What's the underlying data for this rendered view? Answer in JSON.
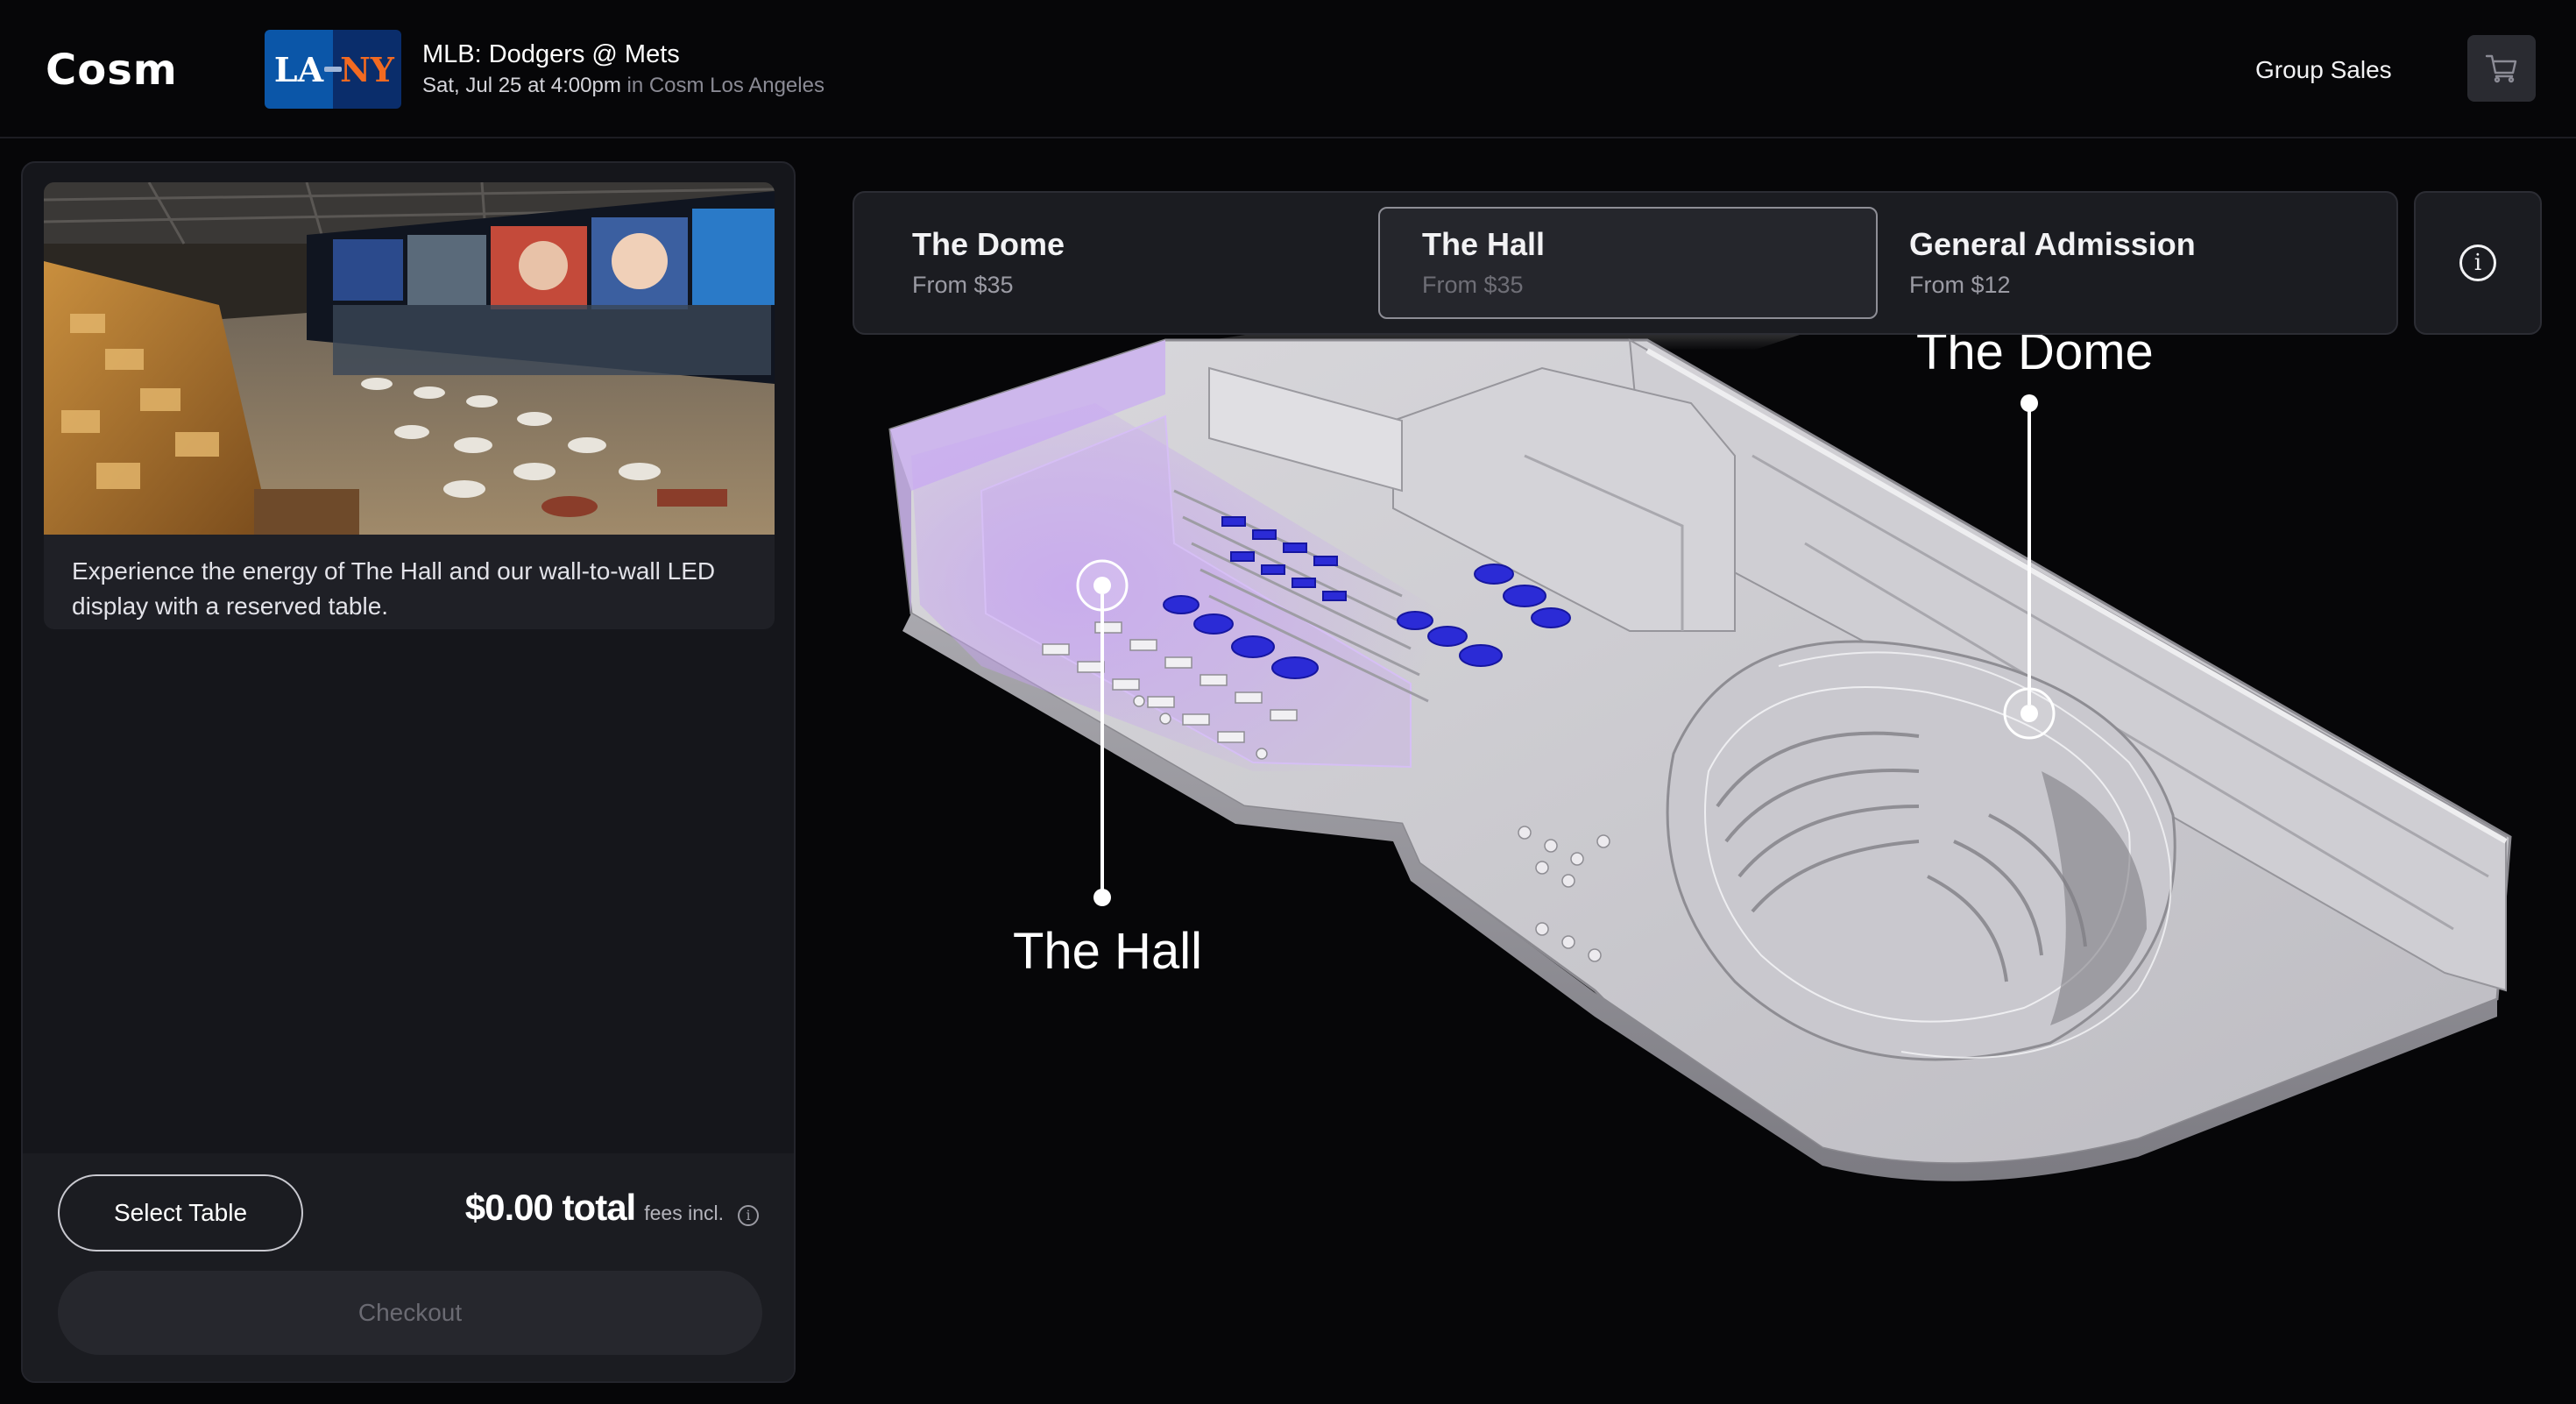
{
  "header": {
    "logo": "Cosm",
    "team_badge": {
      "away": "LA",
      "home": "NY"
    },
    "event_title": "MLB: Dodgers @ Mets",
    "event_datetime": "Sat, Jul 25 at 4:00pm",
    "event_location": "in Cosm Los Angeles",
    "group_sales": "Group Sales",
    "cart_icon": "shopping-cart-icon"
  },
  "panel": {
    "description": "Experience the energy of The Hall and our wall-to-wall LED display with a reserved table.",
    "select_table": "Select Table",
    "total_amount": "$0.00 total",
    "fees_label": "fees incl.",
    "info_glyph": "i",
    "checkout": "Checkout"
  },
  "tabs": [
    {
      "name": "The Dome",
      "price": "From $35"
    },
    {
      "name": "The Hall",
      "price": "From $35",
      "selected": true
    },
    {
      "name": "General Admission",
      "price": "From $12"
    }
  ],
  "info_button": "i",
  "map": {
    "hall_label": "The Hall",
    "dome_label": "The Dome"
  },
  "colors": {
    "background": "#060608",
    "panel": "#15161b",
    "hall_highlight": "#c9a8f0",
    "table_blue": "#2a2ad8"
  }
}
